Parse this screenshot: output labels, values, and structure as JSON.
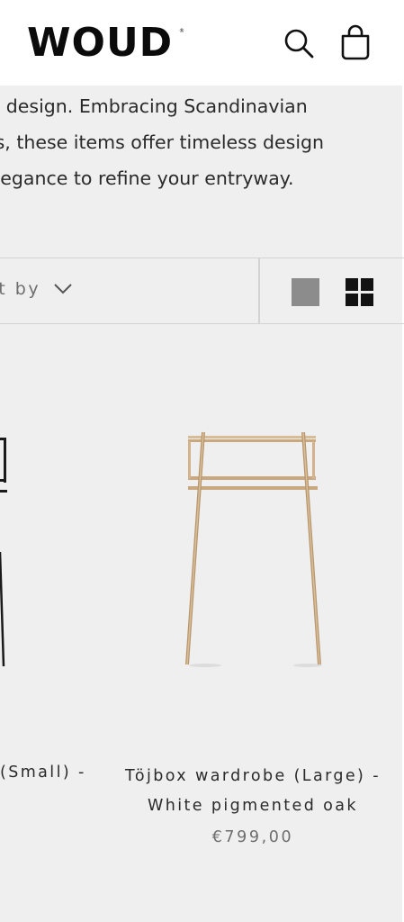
{
  "header": {
    "logo": "WOUD",
    "logo_registered": "®",
    "icons": [
      "search-icon",
      "shopping-bag-icon"
    ]
  },
  "intro": {
    "lines": [
      "al design. Embracing Scandinavian",
      "es, these items offer timeless design",
      "elegance to refine your entryway."
    ]
  },
  "toolbar": {
    "sort_label": "rt by",
    "view_options": [
      "single-column-view",
      "grid-view"
    ],
    "active_view": "grid-view"
  },
  "products": [
    {
      "name_visible": "(Small) -"
    },
    {
      "name_line1": "Töjbox wardrobe (Large) -",
      "name_line2": "White pigmented oak",
      "price": "€799,00"
    }
  ],
  "colors": {
    "background": "#efefef",
    "header_background": "#ffffff",
    "text": "#2a2a2a",
    "muted_text": "#6e6e6e",
    "wood": "#c9a77f"
  }
}
